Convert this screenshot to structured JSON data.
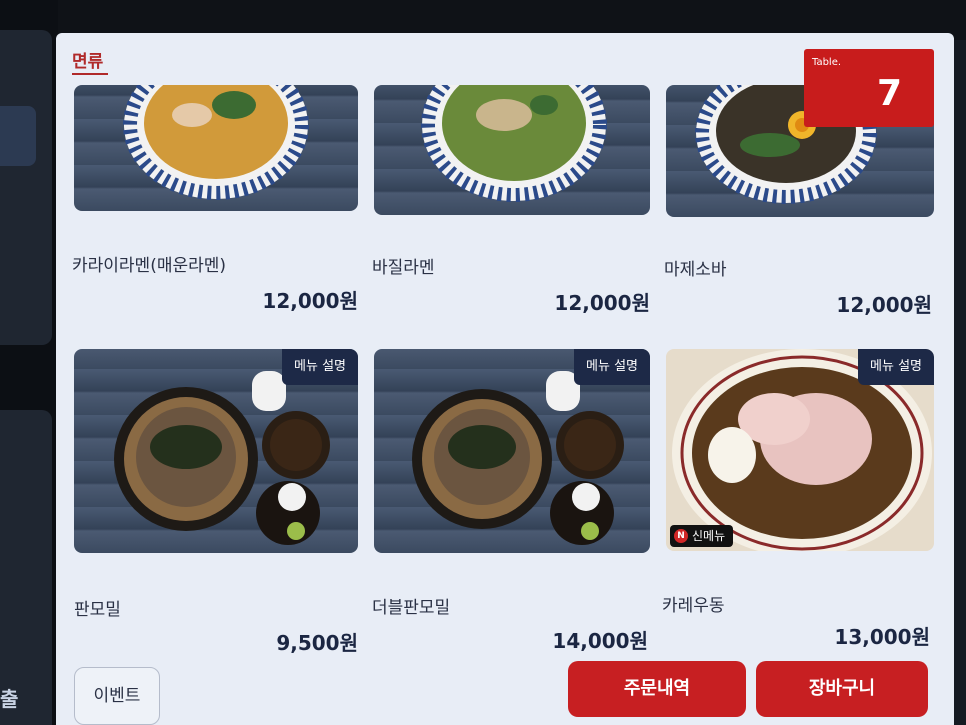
{
  "category": {
    "title": "면류"
  },
  "table": {
    "label": "Table.",
    "number": "7"
  },
  "menu_tag_label": "메뉴 설명",
  "new_tag_label": "신메뉴",
  "new_tag_mark": "N",
  "items": [
    {
      "name": "카라이라멘(매운라멘)",
      "price": "12,000원",
      "broth": "#d19a3a"
    },
    {
      "name": "바질라멘",
      "price": "12,000원",
      "broth": "#6a8a3a"
    },
    {
      "name": "마제소바",
      "price": "12,000원",
      "broth": "#3a3328"
    },
    {
      "name": "판모밀",
      "price": "9,500원"
    },
    {
      "name": "더블판모밀",
      "price": "14,000원"
    },
    {
      "name": "카레우동",
      "price": "13,000원",
      "broth": "#5a3a1c"
    }
  ],
  "footer": {
    "event_label": "이벤트",
    "order_history_label": "주문내역",
    "cart_label": "장바구니"
  },
  "side": {
    "exit_fragment": "출"
  },
  "colors": {
    "accent": "#c71f22",
    "tag_bg": "#1d2947",
    "screen_bg": "#e8edf6"
  }
}
